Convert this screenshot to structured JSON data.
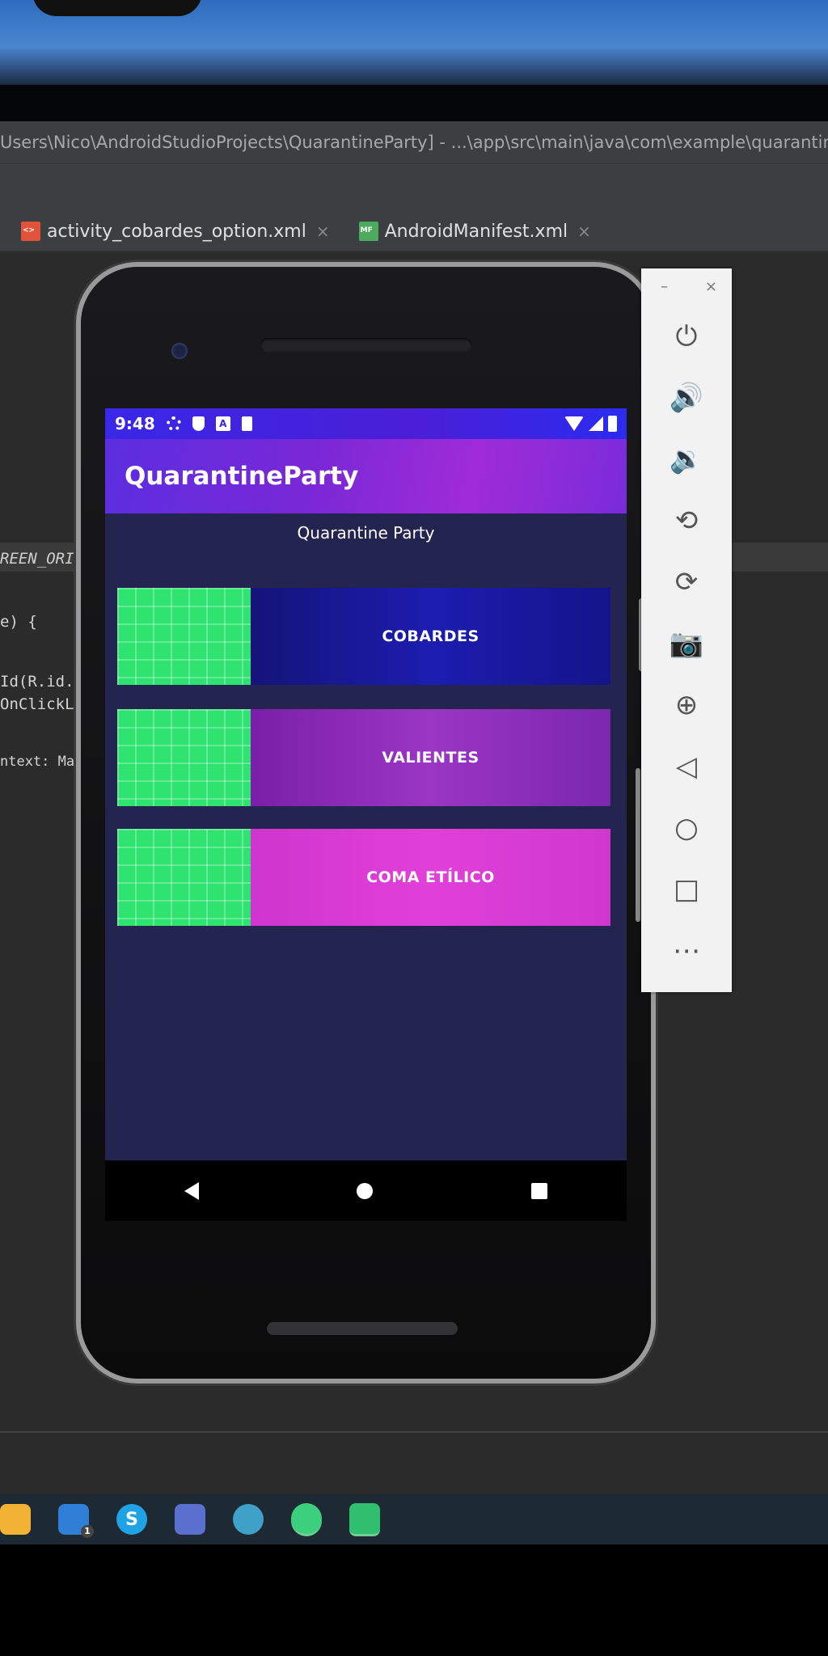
{
  "ide": {
    "title": "Users\\Nico\\AndroidStudioProjects\\QuarantineParty] - ...\\app\\src\\main\\java\\com\\example\\quarantineparty",
    "tabs": [
      {
        "label": "activity_cobardes_option.xml",
        "icon": "xml-file-icon"
      },
      {
        "label": "AndroidManifest.xml",
        "icon": "manifest-file-icon"
      }
    ],
    "tab_close": "×",
    "code_lines": [
      {
        "text": "{"
      },
      {
        "text": "e) {"
      },
      {
        "text": "REEN_ORIEN"
      },
      {
        "text": "Id(R.id.cob"
      },
      {
        "text": "OnClickList"
      },
      {
        "text": "ntext: MainAc"
      }
    ]
  },
  "phone": {
    "status_bar": {
      "time": "9:48",
      "icons": [
        "gear-icon",
        "shield-icon",
        "a-icon",
        "sd-card-icon",
        "wifi-icon",
        "signal-icon",
        "battery-icon"
      ]
    },
    "app_title": "QuarantineParty",
    "heading": "Quarantine Party",
    "options": [
      {
        "label": "COBARDES",
        "color": "#1a1a9a"
      },
      {
        "label": "VALIENTES",
        "color": "#8a2ab4"
      },
      {
        "label": "COMA ETÍLICO",
        "color": "#d43ad0"
      }
    ],
    "nav": [
      "back-icon",
      "home-icon",
      "recents-icon"
    ]
  },
  "emulator_toolbar": {
    "minimize": "–",
    "close": "×",
    "items": [
      {
        "name": "power-icon",
        "glyph": "⏻"
      },
      {
        "name": "volume-up-icon",
        "glyph": "🔊"
      },
      {
        "name": "volume-down-icon",
        "glyph": "🔉"
      },
      {
        "name": "rotate-left-icon",
        "glyph": "⟲"
      },
      {
        "name": "rotate-right-icon",
        "glyph": "⟳"
      },
      {
        "name": "camera-icon",
        "glyph": "📷"
      },
      {
        "name": "zoom-icon",
        "glyph": "⊕"
      },
      {
        "name": "back-icon",
        "glyph": "◁"
      },
      {
        "name": "home-icon",
        "glyph": "○"
      },
      {
        "name": "overview-icon",
        "glyph": "□"
      },
      {
        "name": "more-icon",
        "glyph": "⋯"
      }
    ]
  },
  "taskbar": {
    "icons": [
      {
        "name": "store-icon",
        "color": "#f2b233"
      },
      {
        "name": "mail-icon",
        "color": "#2f7fd6",
        "badge": "1"
      },
      {
        "name": "skype-icon",
        "color": "#1fa3e6",
        "glyph": "S"
      },
      {
        "name": "discord-icon",
        "color": "#5b6fcf"
      },
      {
        "name": "headset-icon",
        "color": "#3fa0c8"
      },
      {
        "name": "android-studio-icon",
        "color": "#3ccf7d"
      },
      {
        "name": "app-icon",
        "color": "#2fbf6f"
      }
    ]
  }
}
